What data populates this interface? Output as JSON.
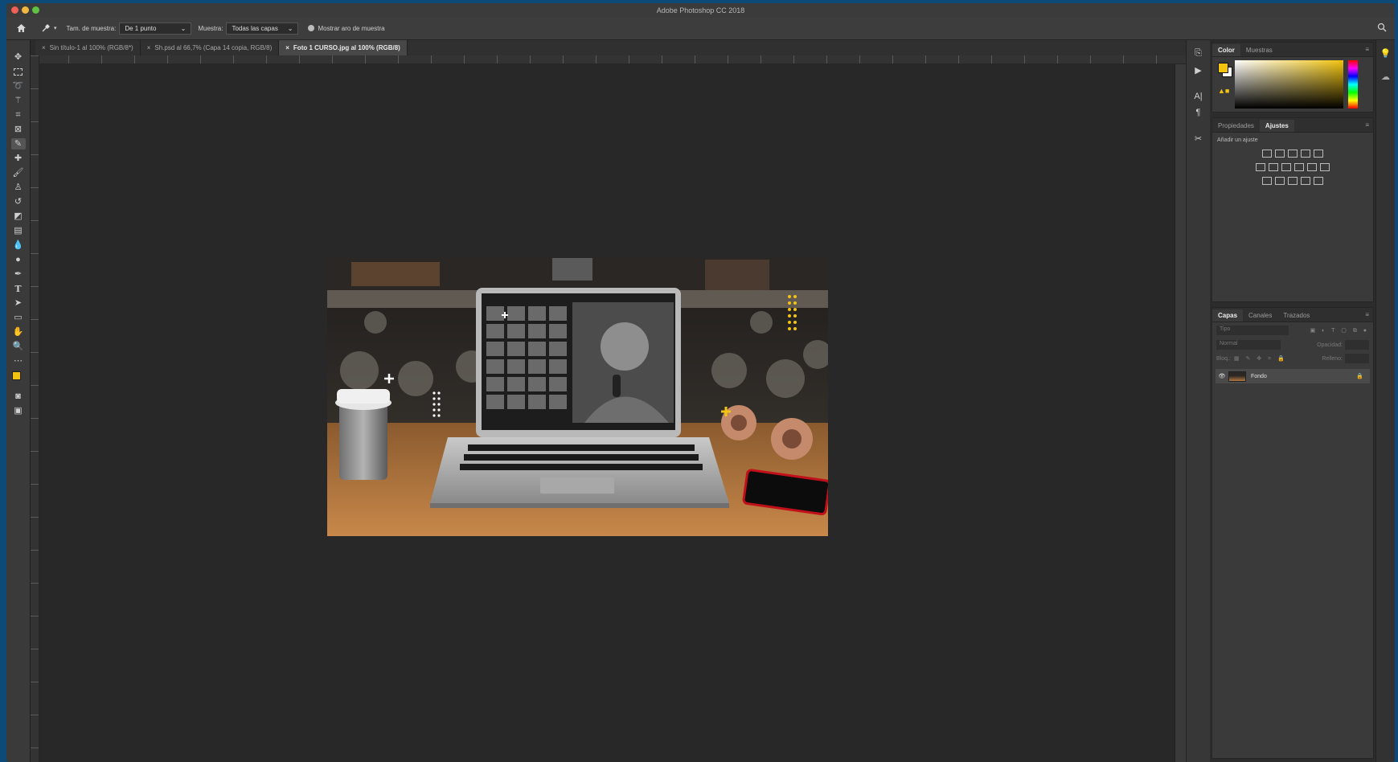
{
  "app": {
    "title": "Adobe Photoshop CC 2018"
  },
  "options_bar": {
    "sample_size_label": "Tam. de muestra:",
    "sample_size_value": "De 1 punto",
    "sample_label": "Muestra:",
    "sample_value": "Todas las capas",
    "show_ring_label": "Mostrar aro de muestra"
  },
  "tabs": [
    {
      "label": "Sin título-1 al 100% (RGB/8*)",
      "active": false
    },
    {
      "label": "Sh.psd al 66,7% (Capa 14 copia, RGB/8)",
      "active": false
    },
    {
      "label": "Foto 1 CURSO.jpg al 100% (RGB/8)",
      "active": true
    }
  ],
  "color_panel": {
    "tabs": [
      "Color",
      "Muestras"
    ],
    "foreground": "#f2c40f",
    "background": "#ffffff"
  },
  "adjustments_panel": {
    "tabs": [
      "Propiedades",
      "Ajustes"
    ],
    "hint": "Añadir un ajuste"
  },
  "layers_panel": {
    "tabs": [
      "Capas",
      "Canales",
      "Trazados"
    ],
    "search_placeholder": "Tipo",
    "blend_mode": "Normal",
    "opacity_label": "Opacidad:",
    "lock_label": "Bloq.:",
    "fill_label": "Relleno:",
    "layers": [
      {
        "name": "Fondo",
        "visible": true,
        "locked": true
      }
    ]
  },
  "colors": {
    "accent_yellow": "#f2c40f",
    "window_bg": "#2b2b2b",
    "desktop": "#0e4a78"
  }
}
